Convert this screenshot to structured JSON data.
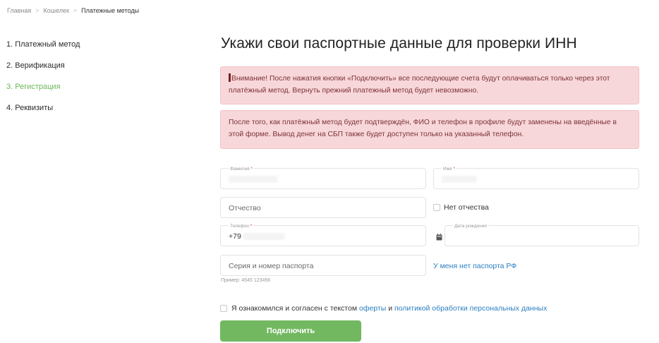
{
  "breadcrumb": {
    "items": [
      "Главная",
      "Кошелек",
      "Платежные методы"
    ],
    "separator": ">"
  },
  "steps": [
    {
      "label": "1. Платежный метод",
      "active": false
    },
    {
      "label": "2. Верификация",
      "active": false
    },
    {
      "label": "3. Регистрация",
      "active": true
    },
    {
      "label": "4. Реквизиты",
      "active": false
    }
  ],
  "page": {
    "title": "Укажи свои паспортные данные для проверки ИНН"
  },
  "alerts": {
    "warning": "Внимание! После нажатия кнопки «Подключить» все последующие счета будут оплачиваться только через этот платёжный метод. Вернуть прежний платежный метод будет невозможно.",
    "info": "После того, как платёжный метод будет подтверждён, ФИО и телефон в профиле будут заменены на введённые в этой форме. Вывод денег на СБП также будет доступен только на указанный телефон."
  },
  "form": {
    "surname_label": "Фамилия",
    "name_label": "Имя",
    "required_mark": "*",
    "patronymic_placeholder": "Отчество",
    "no_patronymic_label": "Нет отчества",
    "phone_label": "Телефон",
    "phone_prefix": "+79",
    "birthdate_label": "Дата рождения",
    "passport_placeholder": "Серия и номер паспорта",
    "passport_hint": "Пример: 4545 123456",
    "no_passport_link": "У меня нет паспорта РФ",
    "agree_prefix": "Я ознакомился и согласен с текстом",
    "agree_offer_link": "оферты",
    "agree_and": "и",
    "agree_policy_link": "политикой обработки персональных данных",
    "submit_label": "Подключить"
  },
  "colors": {
    "accent_green": "#72b860",
    "link_blue": "#2a7fc0",
    "alert_bg": "#f8d7da",
    "alert_text": "#7a3238"
  }
}
